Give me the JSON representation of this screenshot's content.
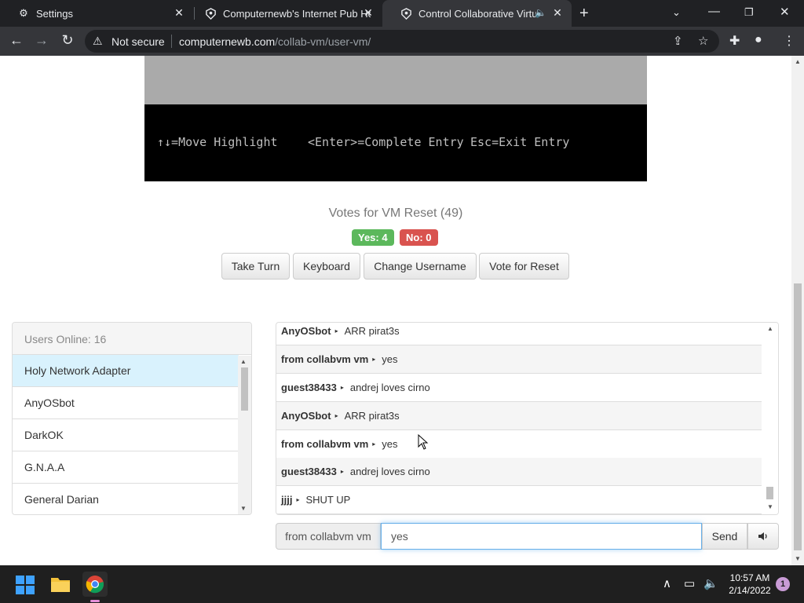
{
  "browser": {
    "tabs": [
      {
        "title": "Settings",
        "icon": "gear-icon",
        "active": false
      },
      {
        "title": "Computernewb's Internet Pub Ho",
        "icon": "collabvm-icon",
        "active": false
      },
      {
        "title": "Control Collaborative Virtual",
        "icon": "collabvm-icon",
        "active": true,
        "audio": true
      }
    ],
    "security_label": "Not secure",
    "url_host": "computernewb.com",
    "url_path": "/collab-vm/user-vm/"
  },
  "vm": {
    "help_move": "↑↓=Move Highlight",
    "help_enter": "<Enter>=Complete Entry",
    "help_esc": "Esc=Exit Entry"
  },
  "votes": {
    "title": "Votes for VM Reset (49)",
    "yes_label": "Yes: 4",
    "no_label": "No: 0"
  },
  "actions": {
    "take_turn": "Take Turn",
    "keyboard": "Keyboard",
    "change_username": "Change Username",
    "vote_reset": "Vote for Reset"
  },
  "users": {
    "header": "Users Online: 16",
    "list": [
      "Holy Network Adapter",
      "AnyOSbot",
      "DarkOK",
      "G.N.A.A",
      "General Darian"
    ]
  },
  "chat": {
    "messages": [
      {
        "user": "AnyOSbot",
        "text": "ARR pirat3s"
      },
      {
        "user": "from collabvm vm",
        "text": "yes"
      },
      {
        "user": "guest38433",
        "text": "andrej loves cirno"
      },
      {
        "user": "AnyOSbot",
        "text": "ARR pirat3s"
      },
      {
        "user": "from collabvm vm",
        "text": "yes"
      },
      {
        "user": "guest38433",
        "text": "andrej loves cirno"
      },
      {
        "user": "jjjj",
        "text": "SHUT UP"
      }
    ],
    "username_label": "from collabvm vm",
    "input_value": "yes",
    "send_label": "Send"
  },
  "taskbar": {
    "time": "10:57 AM",
    "date": "2/14/2022",
    "notifications": "1"
  },
  "colors": {
    "vote_yes": "#5cb85c",
    "vote_no": "#d9534f",
    "active_user": "#d9f2fd"
  }
}
